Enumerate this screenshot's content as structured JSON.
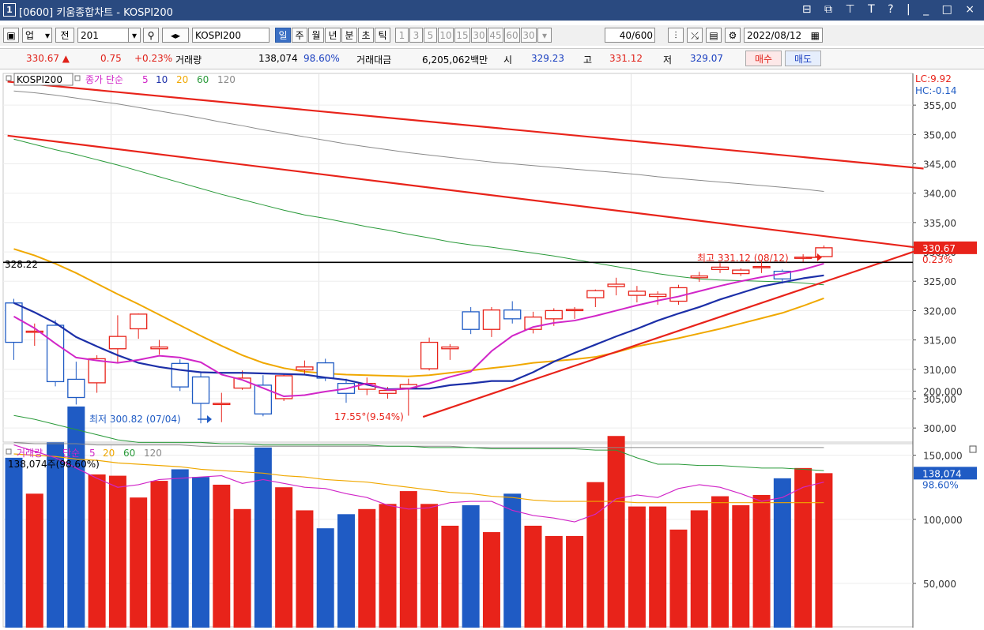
{
  "window": {
    "number": "1",
    "title": "[0600] 키움종합차트 - KOSPI200",
    "controls": "⊟ ⧉ ⊤ T ? | _ □ ×"
  },
  "toolbar": {
    "market": "업",
    "period_select": "전",
    "code": "201",
    "name": "KOSPI200",
    "periods": [
      "일",
      "주",
      "월",
      "년",
      "분",
      "초",
      "틱"
    ],
    "period_selected": "일",
    "minutes": [
      "1",
      "3",
      "5",
      "10",
      "15",
      "30",
      "45",
      "60",
      "30"
    ],
    "count": "40",
    "count_total": "/600",
    "date": "2022/08/12"
  },
  "quote": {
    "price": "330.67 ▲",
    "change": "0.75",
    "change_pct": "+0.23%",
    "volume_label": "거래량",
    "volume": "138,074",
    "volume_pct": "98.60%",
    "amount_label": "거래대금",
    "amount": "6,205,062백만",
    "open_label": "시",
    "open": "329.23",
    "high_label": "고",
    "high": "331.12",
    "low_label": "저",
    "low": "329.07",
    "buy": "매수",
    "sell": "매도"
  },
  "price_panel": {
    "legend": {
      "symbol": "KOSPI200",
      "ma_label": "종가 단순",
      "periods": [
        "5",
        "10",
        "20",
        "60",
        "120"
      ]
    },
    "lc": "LC:9.92",
    "hc": "HC:-0.14",
    "ref_level_label": "328.22",
    "high_annotation": "최고 331.12 (08/12)",
    "low_annotation": "최저 300.82 (07/04)",
    "trend_annotation": "17.55°(9.54%)",
    "last_price_tag": "330.67",
    "last_pct_tag": "0.23%"
  },
  "volume_panel": {
    "legend": {
      "label": "거래량",
      "ma_label": "단순",
      "periods": [
        "5",
        "20",
        "60",
        "120"
      ]
    },
    "current_text": "138,074주(98.60%)",
    "last_volume_tag": "138,074",
    "last_pct_tag": "98.60%"
  },
  "colors": {
    "up": "#e8231a",
    "down": "#1f5bc4",
    "ma5": "#d126c8",
    "ma10": "#1c2fa8",
    "ma20": "#f0a800",
    "ma60": "#2a9a3a",
    "ma120": "#8a8a8a"
  },
  "chart_data": {
    "type": "candlestick",
    "price_axis": {
      "ticks": [
        300,
        305,
        310,
        315,
        320,
        325,
        330,
        335,
        340,
        345,
        350,
        355
      ],
      "ylim": [
        297.6,
        360.4
      ]
    },
    "volume_axis": {
      "ticks": [
        50000,
        100000,
        150000,
        200000
      ]
    },
    "candles": [
      {
        "o": 321.3,
        "c": 314.6,
        "h": 322.0,
        "l": 311.6
      },
      {
        "o": 316.5,
        "c": 316.5,
        "h": 317.8,
        "l": 314.0
      },
      {
        "o": 317.5,
        "c": 307.9,
        "h": 318.4,
        "l": 307.1
      },
      {
        "o": 308.3,
        "c": 305.2,
        "h": 311.3,
        "l": 304.0
      },
      {
        "o": 307.7,
        "c": 311.8,
        "h": 312.4,
        "l": 306.0
      },
      {
        "o": 313.5,
        "c": 315.6,
        "h": 319.2,
        "l": 311.0
      },
      {
        "o": 316.9,
        "c": 319.4,
        "h": 319.5,
        "l": 315.2
      },
      {
        "o": 313.5,
        "c": 313.8,
        "h": 315.0,
        "l": 312.5
      },
      {
        "o": 311.0,
        "c": 307.0,
        "h": 311.7,
        "l": 306.3
      },
      {
        "o": 308.7,
        "c": 304.2,
        "h": 309.4,
        "l": 300.8
      },
      {
        "o": 304.2,
        "c": 304.2,
        "h": 306.0,
        "l": 301.0
      },
      {
        "o": 306.8,
        "c": 308.5,
        "h": 309.8,
        "l": 306.5
      },
      {
        "o": 307.3,
        "c": 302.4,
        "h": 309.0,
        "l": 302.0
      },
      {
        "o": 305.0,
        "c": 308.9,
        "h": 309.1,
        "l": 304.6
      },
      {
        "o": 309.9,
        "c": 310.4,
        "h": 311.5,
        "l": 309.0
      },
      {
        "o": 311.1,
        "c": 308.5,
        "h": 311.8,
        "l": 308.0
      },
      {
        "o": 307.6,
        "c": 305.9,
        "h": 308.4,
        "l": 304.3
      },
      {
        "o": 306.6,
        "c": 307.6,
        "h": 308.6,
        "l": 305.6
      },
      {
        "o": 305.9,
        "c": 306.4,
        "h": 307.0,
        "l": 305.0
      },
      {
        "o": 306.8,
        "c": 307.4,
        "h": 308.4,
        "l": 302.1
      },
      {
        "o": 310.1,
        "c": 314.6,
        "h": 315.4,
        "l": 309.8
      },
      {
        "o": 313.5,
        "c": 313.8,
        "h": 314.3,
        "l": 311.6
      },
      {
        "o": 319.8,
        "c": 316.8,
        "h": 320.6,
        "l": 316.0
      },
      {
        "o": 316.8,
        "c": 320.1,
        "h": 320.6,
        "l": 315.5
      },
      {
        "o": 320.1,
        "c": 318.6,
        "h": 321.6,
        "l": 317.8
      },
      {
        "o": 316.8,
        "c": 318.9,
        "h": 319.8,
        "l": 316.1
      },
      {
        "o": 318.6,
        "c": 320.0,
        "h": 320.4,
        "l": 317.4
      },
      {
        "o": 320.1,
        "c": 320.2,
        "h": 320.6,
        "l": 318.6
      },
      {
        "o": 322.2,
        "c": 323.4,
        "h": 323.6,
        "l": 320.6
      },
      {
        "o": 324.1,
        "c": 324.5,
        "h": 325.6,
        "l": 322.6
      },
      {
        "o": 322.6,
        "c": 323.3,
        "h": 324.2,
        "l": 321.4
      },
      {
        "o": 322.4,
        "c": 322.8,
        "h": 323.3,
        "l": 321.0
      },
      {
        "o": 321.6,
        "c": 323.9,
        "h": 324.4,
        "l": 321.0
      },
      {
        "o": 325.6,
        "c": 325.9,
        "h": 326.6,
        "l": 324.9
      },
      {
        "o": 327.0,
        "c": 327.4,
        "h": 328.1,
        "l": 326.4
      },
      {
        "o": 326.3,
        "c": 326.9,
        "h": 327.2,
        "l": 325.9
      },
      {
        "o": 327.4,
        "c": 327.5,
        "h": 328.6,
        "l": 326.4
      },
      {
        "o": 326.7,
        "c": 325.4,
        "h": 327.0,
        "l": 324.6
      },
      {
        "o": 329.0,
        "c": 329.1,
        "h": 329.6,
        "l": 328.3
      },
      {
        "o": 329.2,
        "c": 330.7,
        "h": 331.1,
        "l": 329.1
      }
    ],
    "volumes": [
      148000,
      120000,
      160000,
      188000,
      135000,
      134000,
      117000,
      130000,
      139000,
      133000,
      127000,
      108000,
      156000,
      125000,
      107000,
      93000,
      104000,
      108000,
      112000,
      122000,
      112000,
      95000,
      111000,
      90000,
      120000,
      95000,
      87000,
      87000,
      129000,
      165000,
      110000,
      110000,
      92000,
      107000,
      118000,
      111000,
      119000,
      132000,
      140000,
      136000
    ],
    "ma5": [
      319.0,
      317.0,
      314.4,
      312.0,
      311.5,
      311.1,
      311.6,
      312.3,
      312.0,
      311.2,
      309.1,
      308.2,
      306.8,
      305.4,
      305.6,
      306.2,
      306.7,
      307.6,
      306.5,
      306.7,
      307.6,
      308.7,
      309.6,
      313.1,
      315.7,
      317.2,
      317.9,
      318.3,
      319.1,
      320.0,
      320.9,
      321.7,
      322.4,
      323.3,
      324.2,
      325.0,
      325.7,
      326.3,
      327.0,
      328.0
    ],
    "ma10": [
      321.3,
      319.7,
      317.9,
      315.5,
      313.9,
      312.4,
      311.1,
      310.4,
      309.9,
      309.5,
      309.4,
      309.4,
      309.3,
      309.2,
      309.1,
      308.6,
      308.2,
      307.4,
      306.6,
      306.7,
      306.7,
      307.3,
      307.6,
      308.0,
      308.0,
      309.5,
      311.3,
      312.8,
      314.2,
      315.6,
      316.9,
      318.3,
      319.5,
      320.6,
      321.9,
      323.0,
      324.1,
      324.8,
      325.5,
      326.0
    ],
    "ma20": [
      330.5,
      329.4,
      328.0,
      326.4,
      324.6,
      322.8,
      321.1,
      319.3,
      317.5,
      315.7,
      314.0,
      312.4,
      311.1,
      310.2,
      309.6,
      309.3,
      309.1,
      309.0,
      308.9,
      308.8,
      309.0,
      309.4,
      309.8,
      310.2,
      310.6,
      311.1,
      311.4,
      311.7,
      312.1,
      312.9,
      313.9,
      314.6,
      315.3,
      316.1,
      316.9,
      317.8,
      318.7,
      319.6,
      320.8,
      322.1
    ],
    "ma60": [
      349.2,
      348.3,
      347.4,
      346.6,
      345.7,
      344.8,
      343.8,
      342.8,
      341.8,
      340.8,
      339.8,
      338.9,
      338.0,
      337.1,
      336.3,
      335.7,
      335.0,
      334.3,
      333.7,
      333.0,
      332.4,
      331.7,
      331.2,
      330.8,
      330.3,
      329.8,
      329.3,
      328.7,
      328.1,
      327.5,
      326.9,
      326.3,
      325.8,
      325.4,
      325.2,
      325.1,
      325.0,
      324.9,
      324.7,
      324.4
    ],
    "ma120": [
      357.4,
      357.1,
      356.7,
      356.2,
      355.7,
      355.2,
      354.6,
      354.0,
      353.4,
      352.8,
      352.1,
      351.5,
      350.8,
      350.2,
      349.6,
      349.0,
      348.4,
      347.9,
      347.4,
      346.9,
      346.5,
      346.1,
      345.7,
      345.3,
      345.0,
      344.7,
      344.4,
      344.1,
      343.8,
      343.5,
      343.2,
      342.8,
      342.5,
      342.2,
      341.9,
      341.6,
      341.3,
      341.0,
      340.7,
      340.3
    ],
    "vol_ma5": [
      158000,
      153000,
      148000,
      140000,
      132000,
      125000,
      127000,
      131000,
      132000,
      133000,
      134000,
      128000,
      131000,
      128000,
      125000,
      124000,
      120000,
      117000,
      111000,
      108000,
      109000,
      113000,
      114000,
      114000,
      107000,
      103000,
      101000,
      98000,
      104000,
      116000,
      119000,
      117000,
      124000,
      127000,
      125000,
      120000,
      114000,
      117000,
      125000,
      129000
    ],
    "vol_ma20": [
      151000,
      150000,
      149000,
      147000,
      146000,
      144000,
      143000,
      142000,
      141000,
      139000,
      138000,
      137000,
      136000,
      134000,
      133000,
      131000,
      130000,
      129000,
      127000,
      125000,
      123000,
      121000,
      120000,
      118000,
      117000,
      115000,
      114000,
      114000,
      114000,
      114000,
      113000,
      113000,
      113000,
      113000,
      113000,
      113000,
      113000,
      113000,
      113000,
      113000
    ],
    "vol_ma60": [
      181000,
      178000,
      174000,
      170000,
      166000,
      162000,
      160000,
      160000,
      160000,
      160000,
      159000,
      159000,
      158000,
      158000,
      158000,
      158000,
      158000,
      158000,
      157000,
      157000,
      156000,
      156000,
      156000,
      155000,
      155000,
      155000,
      155000,
      155000,
      154000,
      154000,
      148000,
      143000,
      143000,
      142000,
      142000,
      141000,
      140000,
      140000,
      139000,
      138000
    ],
    "vol_ma120": [
      160000,
      159000,
      159000,
      159000,
      158000,
      158000,
      158000,
      158000,
      158000,
      157000,
      157000,
      157000,
      157000,
      157000,
      157000,
      157000,
      157000,
      157000,
      157000,
      157000,
      157000,
      157000,
      156000,
      156000,
      156000,
      156000,
      156000,
      156000,
      156000,
      156000,
      156000,
      156000,
      156000,
      156000,
      156000,
      156000,
      156000,
      156000,
      156000,
      156000
    ],
    "ref_level": 328.22,
    "high": {
      "value": 331.12,
      "date": "08/12"
    },
    "low": {
      "value": 300.82,
      "date": "07/04"
    },
    "trendlines": [
      {
        "from": [
          -0.3,
          359.0
        ],
        "to": [
          43.8,
          344.2
        ],
        "color": "#e8231a"
      },
      {
        "from": [
          -0.3,
          349.8
        ],
        "to": [
          43.8,
          330.6
        ],
        "color": "#e8231a"
      },
      {
        "from": [
          19.7,
          301.9
        ],
        "to": [
          43.8,
          330.6
        ],
        "color": "#e8231a"
      }
    ]
  }
}
